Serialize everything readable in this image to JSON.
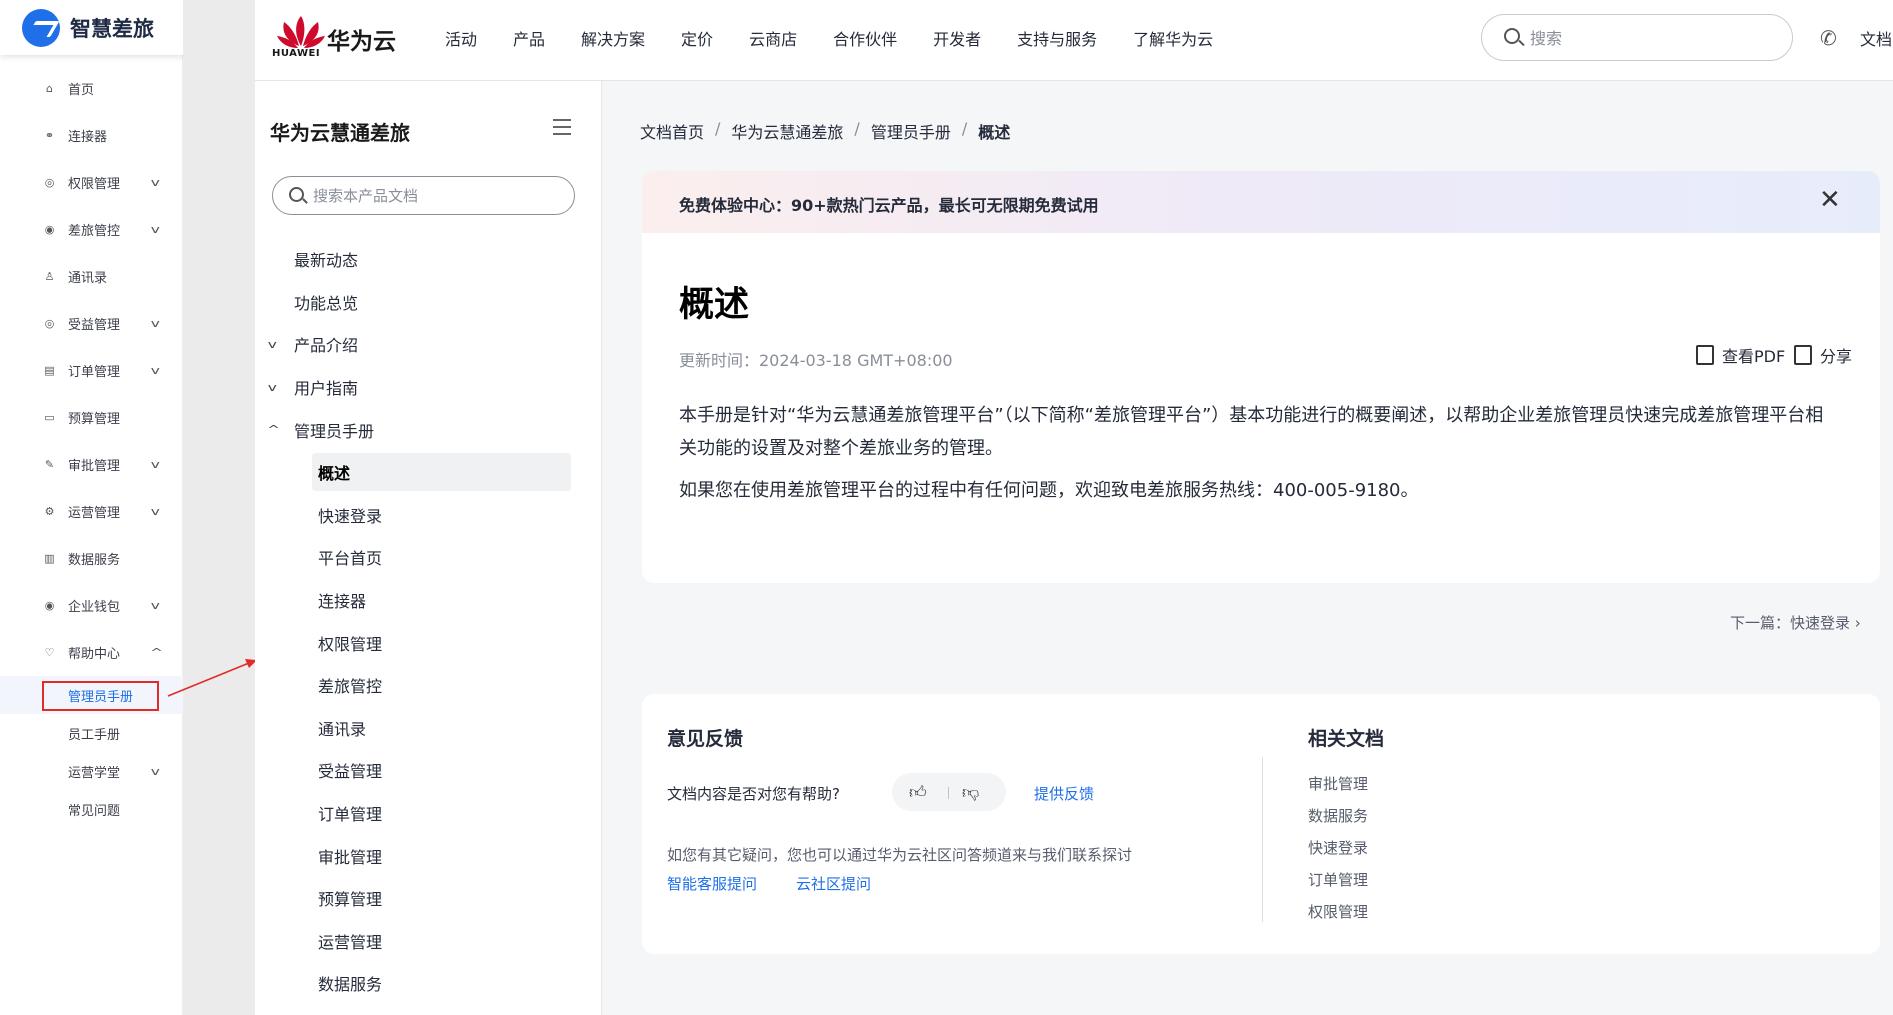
{
  "app": {
    "logo_text": "智慧差旅",
    "nav": [
      {
        "icon": "home-icon",
        "glyph": "⌂",
        "label": "首页",
        "caret": false
      },
      {
        "icon": "link-icon",
        "glyph": "⚭",
        "label": "连接器",
        "caret": false
      },
      {
        "icon": "permission-icon",
        "glyph": "◎",
        "label": "权限管理",
        "caret": true
      },
      {
        "icon": "travel-control-icon",
        "glyph": "◉",
        "label": "差旅管控",
        "caret": true
      },
      {
        "icon": "contacts-icon",
        "glyph": "♙",
        "label": "通讯录",
        "caret": false
      },
      {
        "icon": "benefit-icon",
        "glyph": "◎",
        "label": "受益管理",
        "caret": true
      },
      {
        "icon": "order-icon",
        "glyph": "▤",
        "label": "订单管理",
        "caret": true
      },
      {
        "icon": "budget-icon",
        "glyph": "▭",
        "label": "预算管理",
        "caret": false
      },
      {
        "icon": "approval-icon",
        "glyph": "✎",
        "label": "审批管理",
        "caret": true
      },
      {
        "icon": "operation-icon",
        "glyph": "⚙",
        "label": "运营管理",
        "caret": true
      },
      {
        "icon": "data-icon",
        "glyph": "▥",
        "label": "数据服务",
        "caret": false
      },
      {
        "icon": "wallet-icon",
        "glyph": "◉",
        "label": "企业钱包",
        "caret": true
      },
      {
        "icon": "help-icon",
        "glyph": "♡",
        "label": "帮助中心",
        "caret": true
      }
    ],
    "help_sub": [
      {
        "label": "管理员手册",
        "active": true,
        "caret": false
      },
      {
        "label": "员工手册",
        "active": false,
        "caret": false
      },
      {
        "label": "运营学堂",
        "active": false,
        "caret": true
      },
      {
        "label": "常见问题",
        "active": false,
        "caret": false
      }
    ]
  },
  "header": {
    "brand": "华为云",
    "brand_sub": "HUAWEI",
    "nav": [
      "活动",
      "产品",
      "解决方案",
      "定价",
      "云商店",
      "合作伙伴",
      "开发者",
      "支持与服务",
      "了解华为云"
    ],
    "search_placeholder": "搜索",
    "doc_link": "文档"
  },
  "doc_sidebar": {
    "title": "华为云慧通差旅",
    "search_placeholder": "搜索本产品文档",
    "tree": [
      {
        "label": "最新动态",
        "level": 0,
        "caret": ""
      },
      {
        "label": "功能总览",
        "level": 0,
        "caret": ""
      },
      {
        "label": "产品介绍",
        "level": 0,
        "caret": "v"
      },
      {
        "label": "用户指南",
        "level": 0,
        "caret": "v"
      },
      {
        "label": "管理员手册",
        "level": 0,
        "caret": "^"
      },
      {
        "label": "概述",
        "level": 1,
        "caret": "",
        "active": true
      },
      {
        "label": "快速登录",
        "level": 1,
        "caret": ""
      },
      {
        "label": "平台首页",
        "level": 1,
        "caret": ""
      },
      {
        "label": "连接器",
        "level": 1,
        "caret": ""
      },
      {
        "label": "权限管理",
        "level": 1,
        "caret": ""
      },
      {
        "label": "差旅管控",
        "level": 1,
        "caret": ""
      },
      {
        "label": "通讯录",
        "level": 1,
        "caret": ""
      },
      {
        "label": "受益管理",
        "level": 1,
        "caret": ""
      },
      {
        "label": "订单管理",
        "level": 1,
        "caret": ""
      },
      {
        "label": "审批管理",
        "level": 1,
        "caret": ""
      },
      {
        "label": "预算管理",
        "level": 1,
        "caret": ""
      },
      {
        "label": "运营管理",
        "level": 1,
        "caret": ""
      },
      {
        "label": "数据服务",
        "level": 1,
        "caret": ""
      }
    ]
  },
  "breadcrumb": [
    "文档首页",
    "华为云慧通差旅",
    "管理员手册",
    "概述"
  ],
  "promo": {
    "text": "免费体验中心：90+款热门云产品，最长可无限期免费试用",
    "close": "✕"
  },
  "article": {
    "title": "概述",
    "updated": "更新时间：2024-03-18 GMT+08:00",
    "pdf_label": "查看PDF",
    "share_label": "分享",
    "para1": "本手册是针对“华为云慧通差旅管理平台”（以下简称“差旅管理平台”）基本功能进行的概要阐述，以帮助企业差旅管理员快速完成差旅管理平台相关功能的设置及对整个差旅业务的管理。",
    "para2": "如果您在使用差旅管理平台的过程中有任何问题，欢迎致电差旅服务热线：400-005-9180。"
  },
  "next": "下一篇：快速登录  ›",
  "feedback": {
    "title": "意见反馈",
    "question": "文档内容是否对您有帮助?",
    "provide": "提供反馈",
    "more": "如您有其它疑问，您也可以通过华为云社区问答频道来与我们联系探讨",
    "link1": "智能客服提问",
    "link2": "云社区提问"
  },
  "related": {
    "title": "相关文档",
    "items": [
      "审批管理",
      "数据服务",
      "快速登录",
      "订单管理",
      "权限管理"
    ]
  },
  "colors": {
    "accent": "#1e6fe8",
    "huawei_red": "#cf0a2c",
    "highlight": "#e12b2b"
  }
}
